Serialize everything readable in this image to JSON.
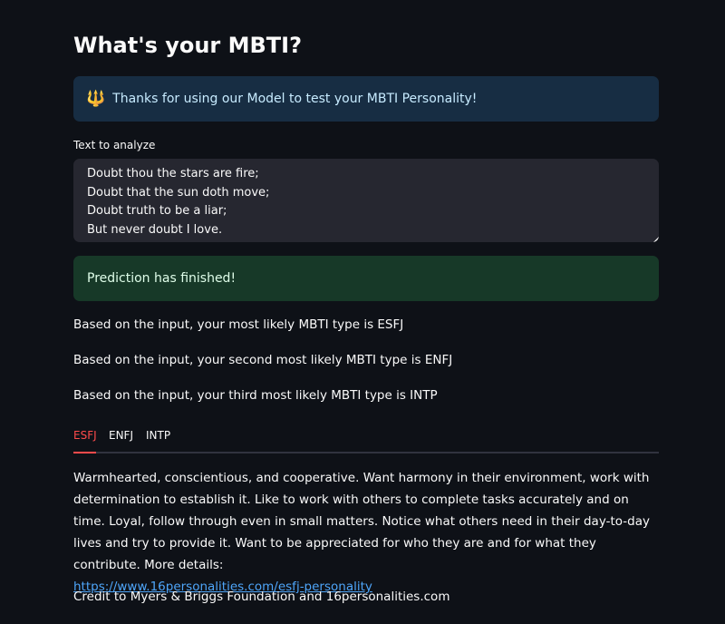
{
  "page": {
    "title": "What's your MBTI?"
  },
  "info": {
    "icon": "trident-icon",
    "glyph": "🔱",
    "text": "Thanks for using our Model to test your MBTI Personality!"
  },
  "input": {
    "label": "Text to analyze",
    "lines": [
      "Doubt thou the stars are fire;",
      "Doubt that the sun doth move;",
      "Doubt truth to be a liar;",
      "But never doubt I love."
    ]
  },
  "status": {
    "text": "Prediction has finished!"
  },
  "results": [
    "Based on the input, your most likely MBTI type is ESFJ",
    "Based on the input, your second most likely MBTI type is ENFJ",
    "Based on the input, your third most likely MBTI type is INTP"
  ],
  "tabs": [
    {
      "label": "ESFJ",
      "active": true
    },
    {
      "label": "ENFJ",
      "active": false
    },
    {
      "label": "INTP",
      "active": false
    }
  ],
  "description": {
    "text": "Warmhearted, conscientious, and cooperative. Want harmony in their environment, work with determination to establish it. Like to work with others to complete tasks accurately and on time. Loyal, follow through even in small matters. Notice what others need in their day-to-day lives and try to provide it. Want to be appreciated for who they are and for what they contribute. More details:",
    "link": "https://www.16personalities.com/esfj-personality"
  },
  "credit": "Credit to Myers & Briggs Foundation and 16personalities.com",
  "colors": {
    "background": "#0e1117",
    "info_bg": "#172d43",
    "success_bg": "#173928",
    "accent": "#ff4b4b",
    "link": "#4ea5f9"
  }
}
